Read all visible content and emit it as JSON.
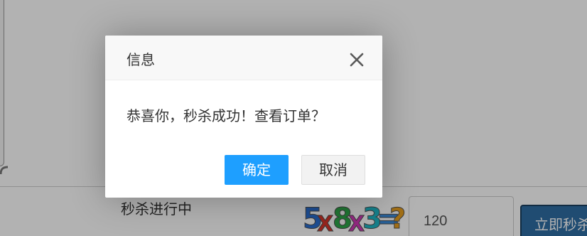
{
  "background": {
    "status_text": "秒杀进行中",
    "captcha_chars": [
      "5",
      "X",
      "8",
      "X",
      "3",
      "=",
      "?"
    ],
    "captcha_input_value": "120",
    "seckill_button_label": "立即秒杀"
  },
  "dialog": {
    "title": "信息",
    "message": "恭喜你，秒杀成功！查看订单？",
    "confirm_label": "确定",
    "cancel_label": "取消"
  },
  "colors": {
    "confirm_button": "#1e9fff",
    "seckill_button": "#2e6da4",
    "overlay": "rgba(0,0,0,0.3)"
  },
  "icons": {
    "close": "close-icon"
  }
}
